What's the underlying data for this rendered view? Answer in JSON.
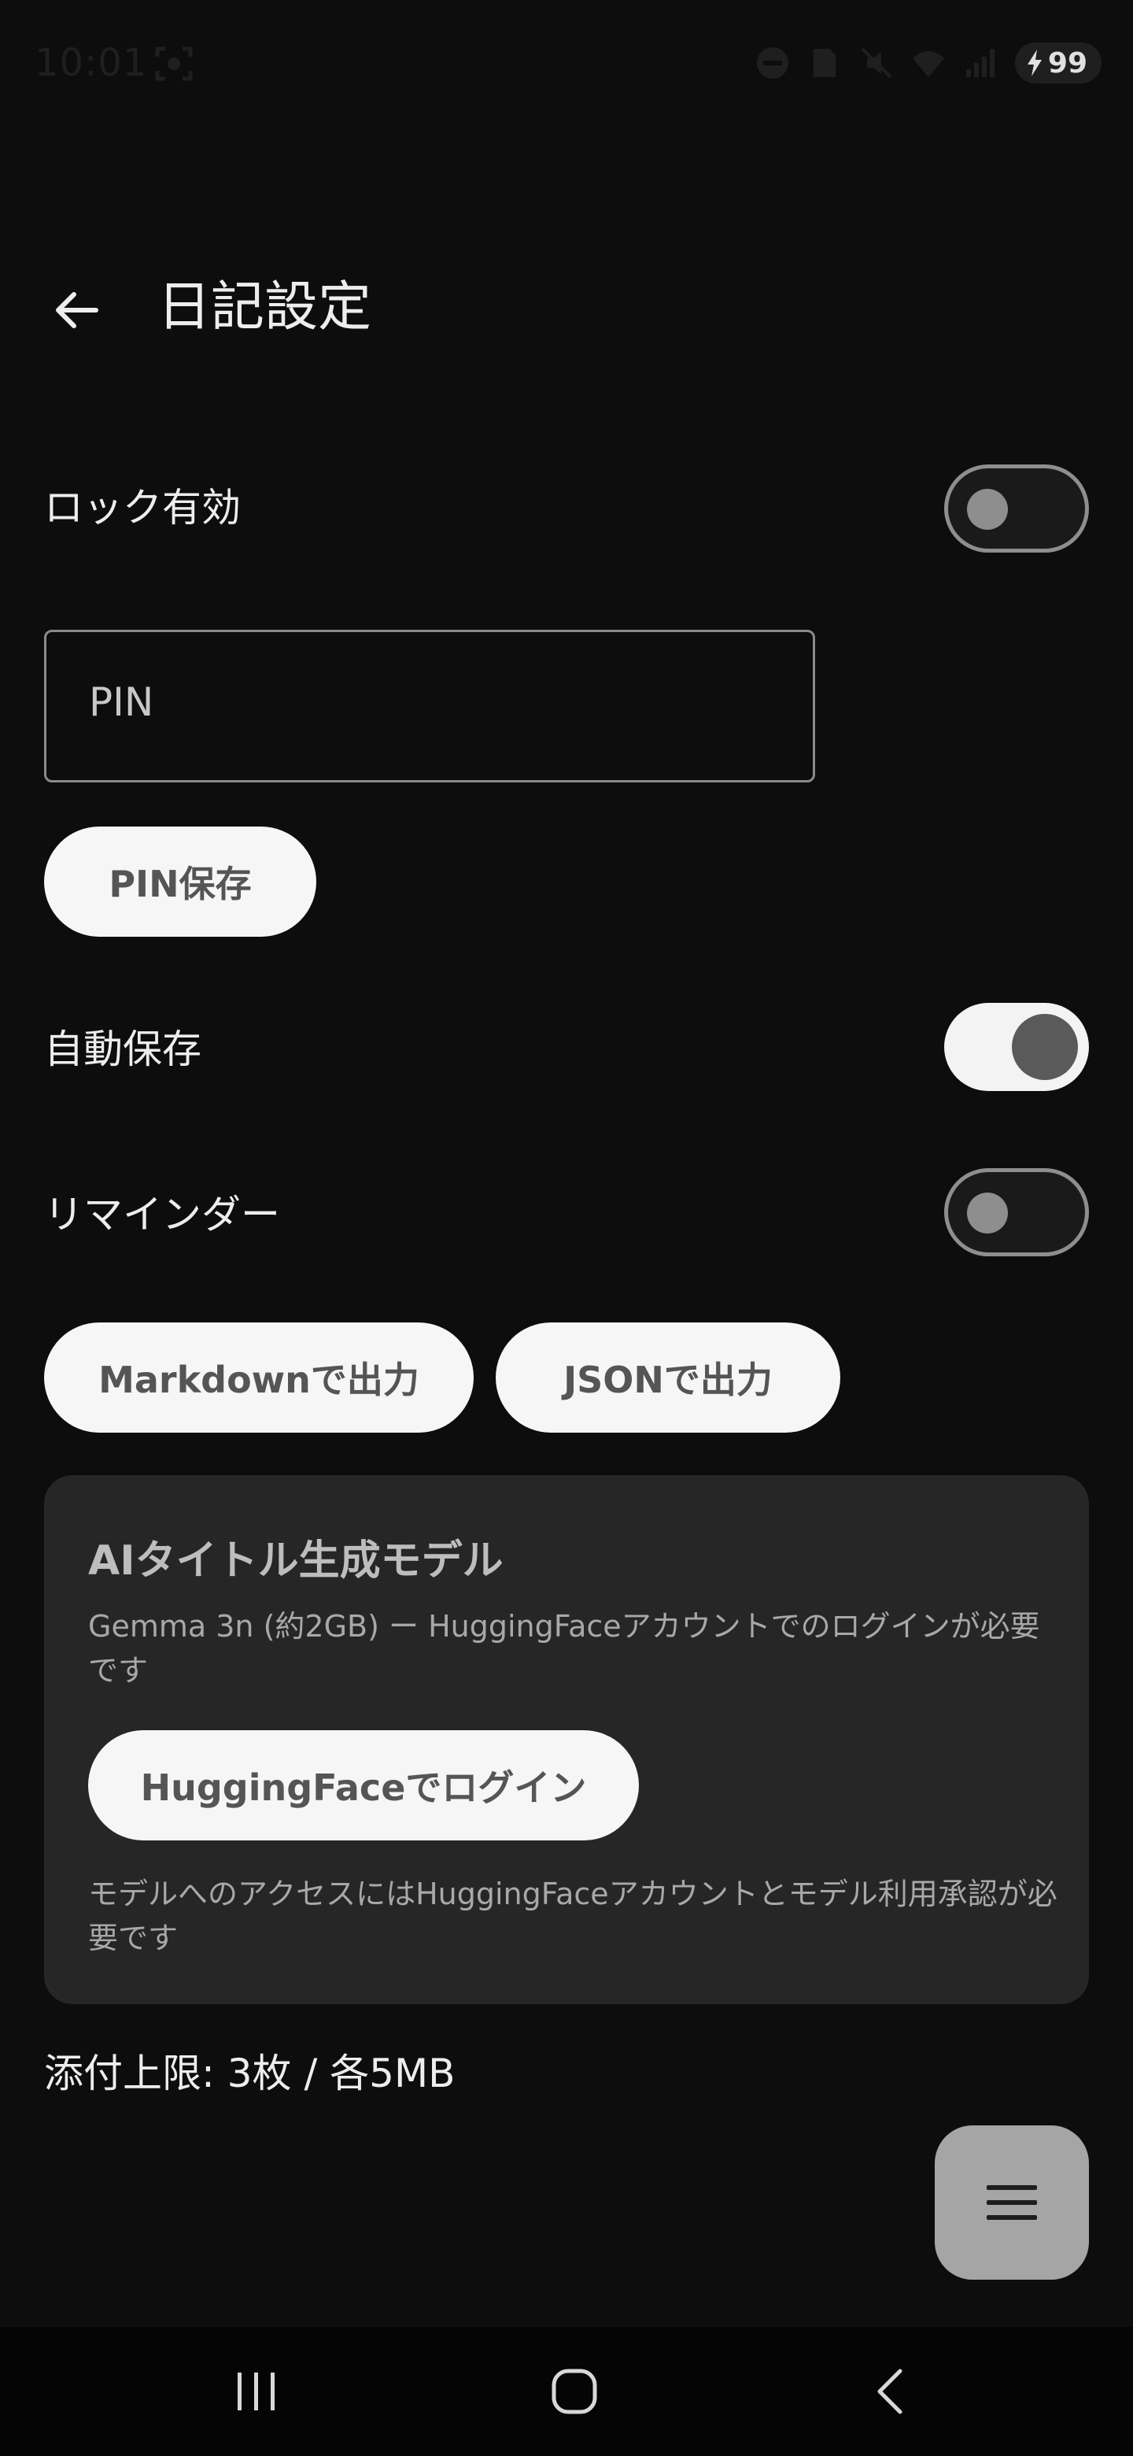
{
  "status_bar": {
    "time": "10:01",
    "battery_level": "99",
    "icons": [
      "screenshot-icon",
      "dnd-icon",
      "sim-icon",
      "mute-icon",
      "wifi-icon",
      "signal-icon",
      "charging-icon"
    ]
  },
  "app_bar": {
    "title": "日記設定",
    "back_icon": "arrow-left-icon"
  },
  "settings": {
    "lock": {
      "label": "ロック有効",
      "enabled": false
    },
    "pin_field": {
      "placeholder": "PIN",
      "value": ""
    },
    "pin_save_button": "PIN保存",
    "autosave": {
      "label": "自動保存",
      "enabled": true
    },
    "reminder": {
      "label": "リマインダー",
      "enabled": false
    }
  },
  "export": {
    "markdown_button": "Markdownで出力",
    "json_button": "JSONで出力"
  },
  "ai_card": {
    "title": "AIタイトル生成モデル",
    "description": "Gemma 3n (約2GB) ー HuggingFaceアカウントでのログインが必要です",
    "login_button": "HuggingFaceでログイン",
    "note": "モデルへのアクセスにはHuggingFaceアカウントとモデル利用承認が必要です"
  },
  "attachment_limit": "添付上限: 3枚 / 各5MB",
  "fab_icon": "menu-icon",
  "nav_bar": {
    "items": [
      "recent-apps-icon",
      "home-icon",
      "back-icon"
    ]
  },
  "colors": {
    "background": "#0d0d0d",
    "card": "#262626",
    "pill_button": "#f6f6f6",
    "fab": "#a5a5a5"
  }
}
